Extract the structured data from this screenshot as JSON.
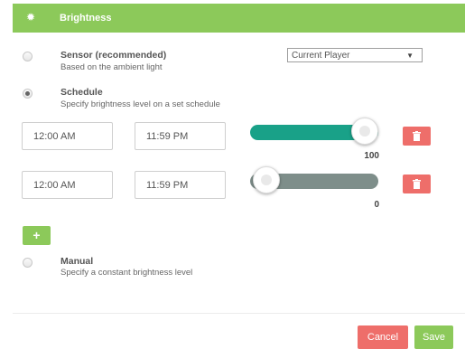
{
  "header": {
    "icon": "gear-icon",
    "title": "Brightness",
    "color": "#8cc95a"
  },
  "options": {
    "sensor": {
      "title": "Sensor (recommended)",
      "description": "Based on the ambient light",
      "selected": false,
      "player_select": {
        "value": "Current Player"
      }
    },
    "schedule": {
      "title": "Schedule",
      "description": "Specify brightness level on a set schedule",
      "selected": true
    },
    "manual": {
      "title": "Manual",
      "description": "Specify a constant brightness level",
      "selected": false
    }
  },
  "schedule_rows": [
    {
      "start": "12:00 AM",
      "end": "11:59 PM",
      "level": 100,
      "level_label": "100",
      "track_color": "#19a188"
    },
    {
      "start": "12:00 AM",
      "end": "11:59 PM",
      "level": 0,
      "level_label": "0",
      "track_color": "#7e8e8a"
    }
  ],
  "add_button": {
    "label": "+",
    "color": "#8cc95a"
  },
  "delete_icon": "trash-icon",
  "footer": {
    "cancel_label": "Cancel",
    "save_label": "Save",
    "cancel_color": "#ee6e6a",
    "save_color": "#8cc95a"
  }
}
